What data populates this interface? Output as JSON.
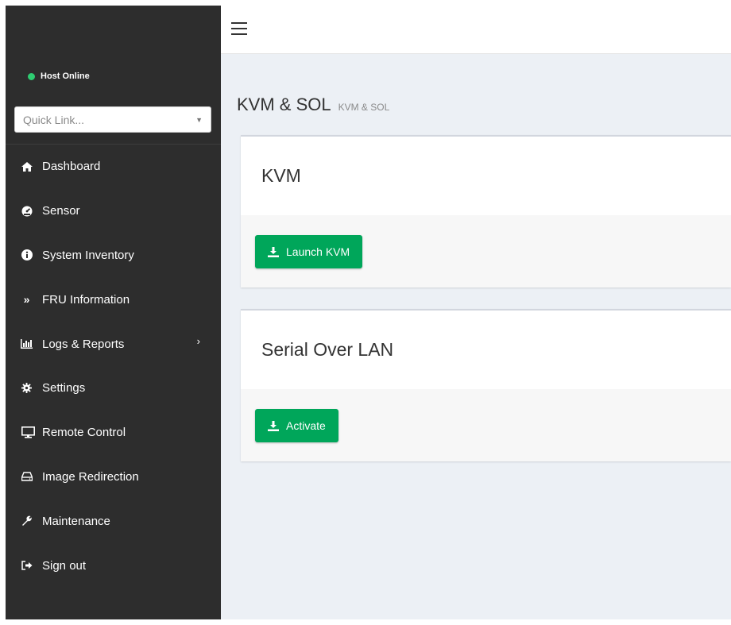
{
  "colors": {
    "accent": "#00a65a",
    "status_online": "#2ecc71",
    "sidebar_bg": "#2d2d2d"
  },
  "sidebar": {
    "host_status": "Host Online",
    "quick_link_placeholder": "Quick Link...",
    "items": [
      {
        "label": "Dashboard",
        "icon": "home-icon"
      },
      {
        "label": "Sensor",
        "icon": "gauge-icon"
      },
      {
        "label": "System Inventory",
        "icon": "info-icon"
      },
      {
        "label": "FRU Information",
        "icon": "double-chevron-right-icon"
      },
      {
        "label": "Logs & Reports",
        "icon": "bar-chart-icon",
        "has_submenu": true
      },
      {
        "label": "Settings",
        "icon": "gear-icon"
      },
      {
        "label": "Remote Control",
        "icon": "monitor-icon"
      },
      {
        "label": "Image Redirection",
        "icon": "hdd-icon"
      },
      {
        "label": "Maintenance",
        "icon": "wrench-icon"
      },
      {
        "label": "Sign out",
        "icon": "sign-out-icon"
      }
    ]
  },
  "header": {
    "title": "KVM & SOL",
    "subtitle": "KVM & SOL"
  },
  "cards": [
    {
      "title": "KVM",
      "button_label": "Launch KVM",
      "button_icon": "download-icon"
    },
    {
      "title": "Serial Over LAN",
      "button_label": "Activate",
      "button_icon": "download-icon"
    }
  ]
}
